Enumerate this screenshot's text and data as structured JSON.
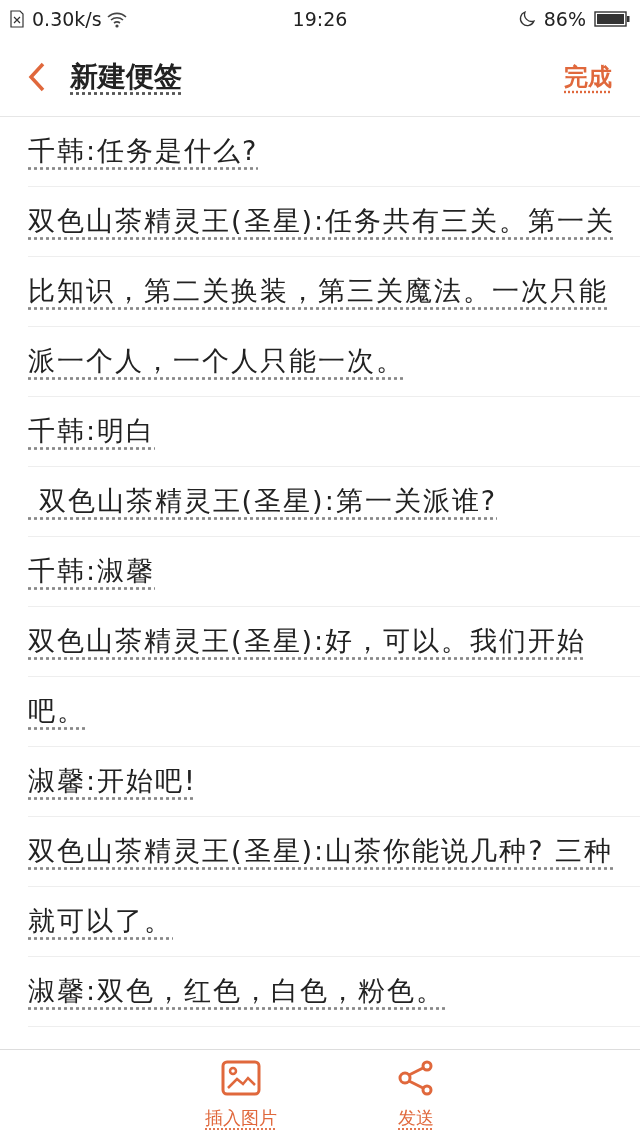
{
  "status_bar": {
    "speed": "0.30k/s",
    "time": "19:26",
    "battery": "86%"
  },
  "header": {
    "title": "新建便签",
    "done": "完成"
  },
  "note_lines": [
    {
      "text": "千韩:任务是什么?"
    },
    {
      "text": "双色山茶精灵王(圣星):任务共有三关。第一关"
    },
    {
      "text": "比知识，第二关换装，第三关魔法。一次只能"
    },
    {
      "text": "派一个人，一个人只能一次。"
    },
    {
      "text": "千韩:明白"
    },
    {
      "text": " 双色山茶精灵王(圣星):第一关派谁?"
    },
    {
      "text": "千韩:淑馨"
    },
    {
      "text": "双色山茶精灵王(圣星):好，可以。我们开始"
    },
    {
      "text": "吧。"
    },
    {
      "text": "淑馨:开始吧!"
    },
    {
      "text": "双色山茶精灵王(圣星):山茶你能说几种? 三种"
    },
    {
      "text": "就可以了。"
    },
    {
      "text": "淑馨:双色，红色，白色，粉色。"
    }
  ],
  "toolbar": [
    {
      "kind": "image",
      "label": "插入图片"
    },
    {
      "kind": "share",
      "label": "发送"
    }
  ]
}
